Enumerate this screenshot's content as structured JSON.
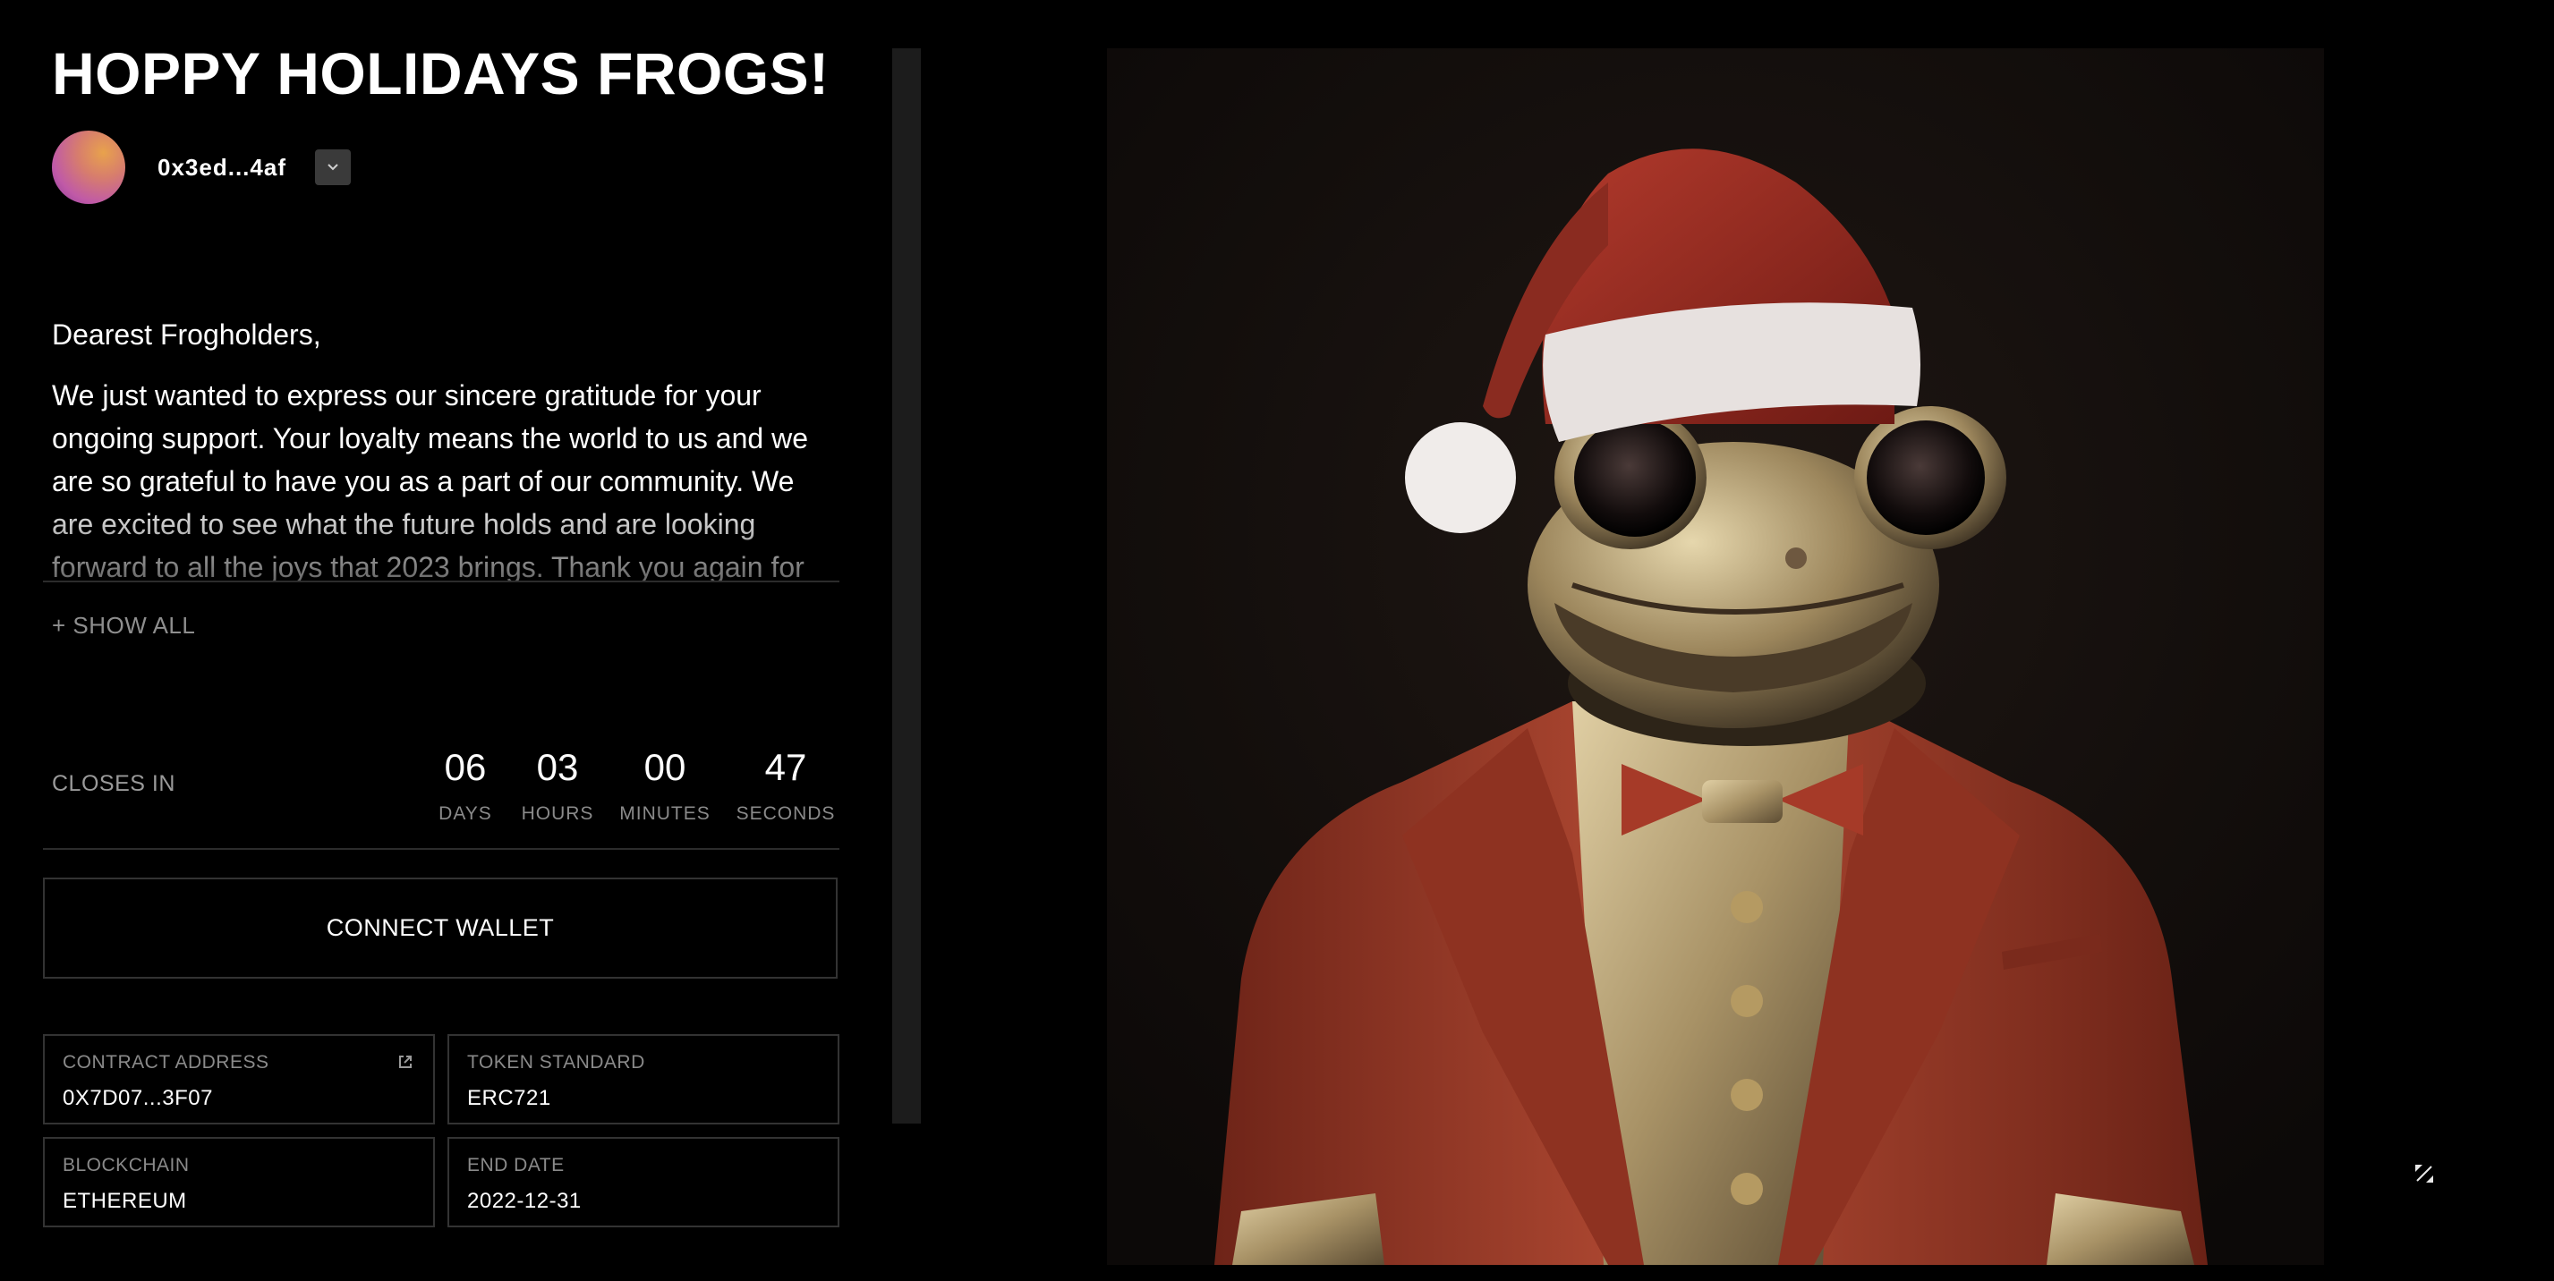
{
  "title": "HOPPY HOLIDAYS FROGS!",
  "author": {
    "name": "0x3ed...4af",
    "dropdown_icon": "chevron-down-icon"
  },
  "description": {
    "paragraphs": [
      "Dearest Frogholders,",
      "We just wanted to express our sincere gratitude for your ongoing support. Your loyalty means the world to us and we are so grateful to have you as a part of our community. We are excited to see what the future holds and are looking forward to all the joys that 2023 brings. Thank you again for"
    ],
    "show_all_label": "+ SHOW ALL"
  },
  "countdown": {
    "label": "CLOSES IN",
    "days": {
      "value": "06",
      "unit": "DAYS"
    },
    "hours": {
      "value": "03",
      "unit": "HOURS"
    },
    "minutes": {
      "value": "00",
      "unit": "MINUTES"
    },
    "seconds": {
      "value": "47",
      "unit": "SECONDS"
    }
  },
  "connect_label": "CONNECT WALLET",
  "details": {
    "contract": {
      "label": "CONTRACT ADDRESS",
      "value": "0X7D07...3F07"
    },
    "token": {
      "label": "TOKEN STANDARD",
      "value": "ERC721"
    },
    "chain": {
      "label": "BLOCKCHAIN",
      "value": "ETHEREUM"
    },
    "end": {
      "label": "END DATE",
      "value": "2022-12-31"
    }
  },
  "artwork": {
    "subject": "frog-in-santa-hat-and-red-tuxedo"
  },
  "colors": {
    "background": "#000000",
    "border": "#333333",
    "muted": "#8a8a8a",
    "jacket": "#a5402e",
    "hat": "#9a2a20"
  }
}
